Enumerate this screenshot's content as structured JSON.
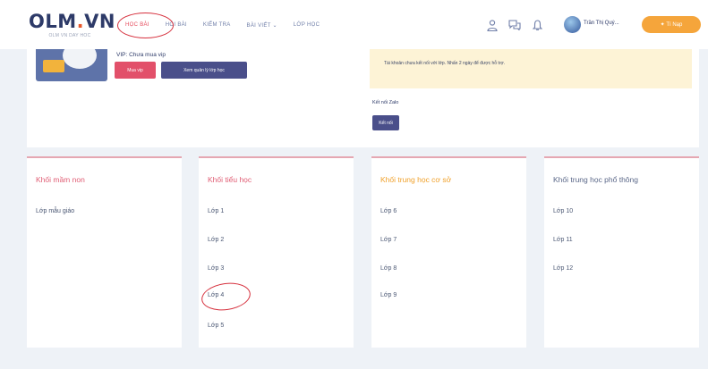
{
  "header": {
    "logo": {
      "brand_left": "OLM",
      "brand_dot": ".",
      "brand_right": "VN",
      "tagline": "OLM VN DAY HOC"
    },
    "nav": [
      {
        "label": "HỌC BÀI",
        "active": true
      },
      {
        "label": "HỎI BÀI",
        "active": false
      },
      {
        "label": "KIỂM TRA",
        "active": false
      },
      {
        "label": "BÀI VIẾT",
        "active": false,
        "has_dropdown": true
      },
      {
        "label": "LỚP HỌC",
        "active": false
      }
    ],
    "icons": [
      "user-icon",
      "chat-icon",
      "bell-icon"
    ],
    "user_name": "Trần Thị Quý...",
    "topup_label": "Tí Nạp",
    "colors": {
      "accent": "#e64b5c",
      "brand_navy": "#2d3a68",
      "topup": "#f5a53b"
    }
  },
  "upper": {
    "vip_title": "VIP: Chưa mua vip",
    "buy_label": "Mua vip",
    "manage_label": "Xem quản lý lớp học",
    "notice_text": "Tài khoản chưa kết nối với lớp. Nhấn 2 ngày để được hỗ trợ.",
    "connect_label": "Kết nối Zalo",
    "connect_button": "Kết nối"
  },
  "levels": [
    {
      "title": "Khối mầm non",
      "title_color": "#e05d74",
      "items": [
        "Lớp mẫu giáo"
      ]
    },
    {
      "title": "Khối tiểu học",
      "title_color": "#e05d74",
      "items": [
        "Lớp 1",
        "Lớp 2",
        "Lớp 3",
        "Lớp 4",
        "Lớp 5"
      ]
    },
    {
      "title": "Khối trung học cơ sở",
      "title_color": "#f0a12b",
      "items": [
        "Lớp 6",
        "Lớp 7",
        "Lớp 8",
        "Lớp 9"
      ]
    },
    {
      "title": "Khối trung học phổ thông",
      "title_color": "#5a6788",
      "items": [
        "Lớp 10",
        "Lớp 11",
        "Lớp 12"
      ]
    }
  ]
}
